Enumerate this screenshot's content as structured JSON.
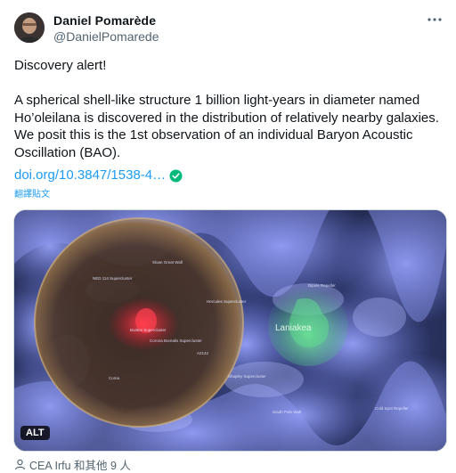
{
  "author": {
    "name": "Daniel Pomarède",
    "handle": "@DanielPomarede"
  },
  "tweet": {
    "text": "Discovery alert!\n\nA spherical shell-like structure 1 billion light-years in diameter named Ho’oleilana is discovered in the distribution of relatively nearby galaxies. We posit this is the 1st observation of an individual Baryon Acoustic Oscillation (BAO).",
    "link": "doi.org/10.3847/1538-4…",
    "translate": "翻譯貼文"
  },
  "media": {
    "alt_badge": "ALT",
    "labels": {
      "bootes": "Boötes Supercluster",
      "laniakea": "Laniakea",
      "shapley": "Shapley Supercluster",
      "south_pole_wall": "South Pole Wall",
      "hercules": "Hercules Supercluster",
      "corona_borealis": "Corona Borealis Supercluster",
      "a2142": "A2142",
      "ned114": "NED 114 Supercluster",
      "sloan_wall": "Sloan Great Wall",
      "dipole_repeller": "Dipole Repeller",
      "cold_spot_repeller": "Cold Spot Repeller",
      "coma": "Coma"
    }
  },
  "tagged": {
    "text": "CEA Irfu 和其他 9 人"
  },
  "colors": {
    "accent": "#1d9bf0",
    "secondary_text": "#536471",
    "verified": "#00ba7c"
  }
}
